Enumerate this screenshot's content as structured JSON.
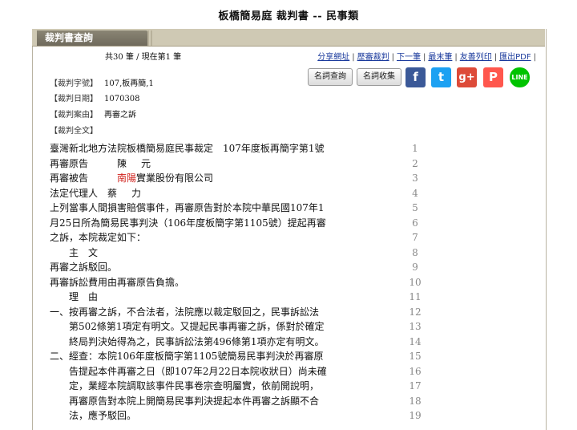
{
  "page_title": "板橋簡易庭 裁判書 -- 民事類",
  "tab": {
    "label": "裁判書查詢"
  },
  "counter": "共30 筆 / 現在第1 筆",
  "top_links": [
    "分享網址",
    "歷審裁判",
    "下一筆",
    "最末筆",
    "友善列印",
    "匯出PDF"
  ],
  "buttons": {
    "term_query": "名詞查詢",
    "term_collect": "名詞收集"
  },
  "social_icons": [
    {
      "name": "facebook-icon",
      "glyph": "f",
      "color": "#3b5998"
    },
    {
      "name": "twitter-icon",
      "glyph": "t",
      "color": "#1da1f2"
    },
    {
      "name": "google-plus-icon",
      "glyph": "g+",
      "color": "#dd4b39"
    },
    {
      "name": "plurk-icon",
      "glyph": "P",
      "color": "#ff574d"
    },
    {
      "name": "line-icon",
      "glyph": "LINE",
      "color": "#00c300"
    }
  ],
  "meta": {
    "case_no_label": "【裁判字號】",
    "case_no": "107,板再簡,1",
    "date_label": "【裁判日期】",
    "date": "1070308",
    "cause_label": "【裁判案由】",
    "cause": "再審之訴",
    "fulltext_label": "【裁判全文】"
  },
  "document_lines": [
    {
      "n": "1",
      "text": "臺灣新北地方法院板橋簡易庭民事裁定　107年度板再簡字第1號"
    },
    {
      "n": "2",
      "a": "再審原告　　　陳",
      "b": "元"
    },
    {
      "n": "3",
      "a": "再審被告　　　",
      "red": "南陽",
      "b": "實業股份有限公司"
    },
    {
      "n": "4",
      "a": "法定代理人　蔡",
      "b": "力"
    },
    {
      "n": "5",
      "text": "上列當事人間損害賠償事件，再審原告對於本院中華民國107年1"
    },
    {
      "n": "6",
      "text": "月25日所為簡易民事判決（106年度板簡字第1105號）提起再審"
    },
    {
      "n": "7",
      "text": "之訴，本院裁定如下："
    },
    {
      "n": "8",
      "text": "　　主　文"
    },
    {
      "n": "9",
      "text": "再審之訴駁回。"
    },
    {
      "n": "10",
      "text": "再審訴訟費用由再審原告負擔。"
    },
    {
      "n": "11",
      "text": "　　理　由"
    },
    {
      "n": "12",
      "text": "一、按再審之訴，不合法者，法院應以裁定駁回之，民事訴訟法"
    },
    {
      "n": "13",
      "text": "　　第502條第1項定有明文。又提起民事再審之訴，係對於確定"
    },
    {
      "n": "14",
      "text": "　　終局判決始得為之，民事訴訟法第496條第1項亦定有明文。"
    },
    {
      "n": "15",
      "text": "二、經查：本院106年度板簡字第1105號簡易民事判決於再審原"
    },
    {
      "n": "16",
      "text": "　　告提起本件再審之日（即107年2月22日本院收狀日）尚未確"
    },
    {
      "n": "17",
      "text": "　　定，業經本院調取該事件民事卷宗查明屬實，依前開說明，"
    },
    {
      "n": "18",
      "text": "　　再審原告對本院上開簡易民事判決提起本件再審之訴顯不合"
    },
    {
      "n": "19",
      "text": "　　法，應予駁回。"
    }
  ]
}
